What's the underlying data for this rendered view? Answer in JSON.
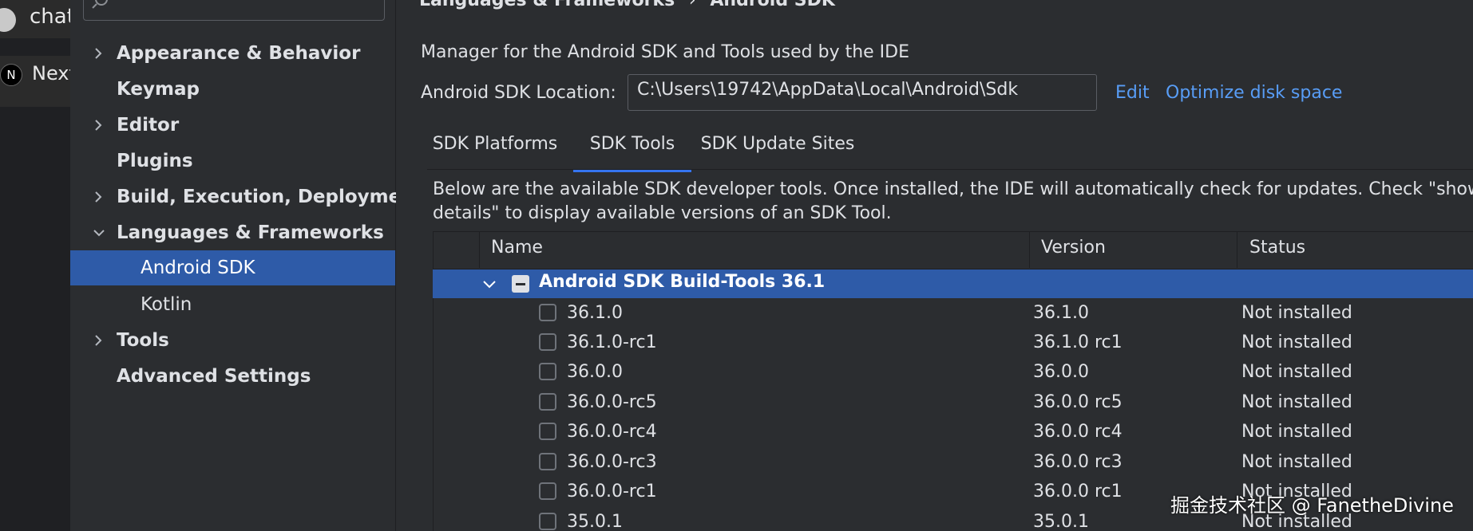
{
  "background_app": {
    "items": [
      {
        "label": "chat"
      },
      {
        "label": "Next"
      }
    ]
  },
  "sidebar": {
    "items": [
      {
        "label": "Appearance & Behavior",
        "expandable": true
      },
      {
        "label": "Keymap",
        "expandable": false
      },
      {
        "label": "Editor",
        "expandable": true
      },
      {
        "label": "Plugins",
        "expandable": false
      },
      {
        "label": "Build, Execution, Deployment",
        "expandable": true
      },
      {
        "label": "Languages & Frameworks",
        "expandable": true,
        "expanded": true
      },
      {
        "label": "Android SDK",
        "selected": true
      },
      {
        "label": "Kotlin"
      },
      {
        "label": "Tools",
        "expandable": true
      },
      {
        "label": "Advanced Settings",
        "expandable": false
      }
    ]
  },
  "breadcrumb": {
    "parent": "Languages & Frameworks",
    "separator": "›",
    "current": "Android SDK"
  },
  "main": {
    "description": "Manager for the Android SDK and Tools used by the IDE",
    "location_label": "Android SDK Location:",
    "location_value": "C:\\Users\\19742\\AppData\\Local\\Android\\Sdk",
    "edit_link": "Edit",
    "optimize_link": "Optimize disk space",
    "tabs": [
      {
        "label": "SDK Platforms",
        "active": false
      },
      {
        "label": "SDK Tools",
        "active": true
      },
      {
        "label": "SDK Update Sites",
        "active": false
      }
    ],
    "info_line1": "Below are the available SDK developer tools. Once installed, the IDE will automatically check for updates. Check \"show pack",
    "info_line2": "details\" to display available versions of an SDK Tool."
  },
  "table": {
    "columns": [
      "Name",
      "Version",
      "Status"
    ],
    "group": {
      "label": "Android SDK Build-Tools 36.1"
    },
    "rows": [
      {
        "name": "36.1.0",
        "version": "36.1.0",
        "status": "Not installed"
      },
      {
        "name": "36.1.0-rc1",
        "version": "36.1.0 rc1",
        "status": "Not installed"
      },
      {
        "name": "36.0.0",
        "version": "36.0.0",
        "status": "Not installed"
      },
      {
        "name": "36.0.0-rc5",
        "version": "36.0.0 rc5",
        "status": "Not installed"
      },
      {
        "name": "36.0.0-rc4",
        "version": "36.0.0 rc4",
        "status": "Not installed"
      },
      {
        "name": "36.0.0-rc3",
        "version": "36.0.0 rc3",
        "status": "Not installed"
      },
      {
        "name": "36.0.0-rc1",
        "version": "36.0.0 rc1",
        "status": "Not installed"
      },
      {
        "name": "35.0.1",
        "version": "35.0.1",
        "status": "Not installed"
      }
    ]
  },
  "watermark": "掘金技术社区 @ FanetheDivine",
  "colors": {
    "background": "#2b2d30",
    "selection": "#2e5ba8",
    "link": "#589df6",
    "tab_underline": "#3574f0"
  }
}
